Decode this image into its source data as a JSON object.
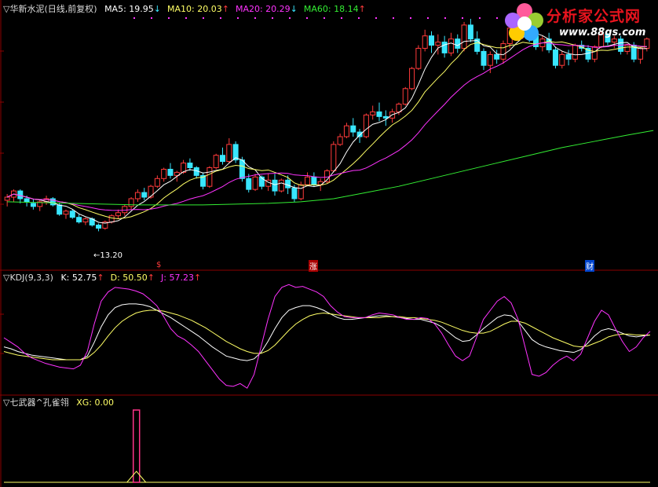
{
  "price_panel": {
    "title": "华新水泥(日线,前复权)",
    "mark": "▽",
    "ma": [
      {
        "label": "MA5:",
        "value": "19.95",
        "arrow": "↓",
        "color": "#ffffff",
        "arrow_color": "#39e6ff"
      },
      {
        "label": "MA10:",
        "value": "20.03",
        "arrow": "↑",
        "color": "#ffff66",
        "arrow_color": "#ff3b3b"
      },
      {
        "label": "MA20:",
        "value": "20.29",
        "arrow": "↓",
        "color": "#ff33ff",
        "arrow_color": "#39e6ff"
      },
      {
        "label": "MA60:",
        "value": "18.14",
        "arrow": "↑",
        "color": "#33ee33",
        "arrow_color": "#ff3b3b"
      }
    ],
    "low_label": "←13.20",
    "markers": [
      "$",
      "涨",
      "财"
    ]
  },
  "kdj_panel": {
    "title": "KDJ(9,3,3)",
    "mark": "▽",
    "items": [
      {
        "label": "K:",
        "value": "52.75",
        "arrow": "↑",
        "color": "#ffffff"
      },
      {
        "label": "D:",
        "value": "50.50",
        "arrow": "↑",
        "color": "#ffff66"
      },
      {
        "label": "J:",
        "value": "57.23",
        "arrow": "↑",
        "color": "#ff33ff"
      }
    ]
  },
  "xg_panel": {
    "title": "七武器^孔雀翎",
    "mark": "▽",
    "label": "XG:",
    "value": "0.00"
  },
  "logo": {
    "text": "分析家公式网",
    "url": "www.88gs.com"
  },
  "colors": {
    "up": "#ff3b3b",
    "down": "#39e6ff",
    "ma5": "#ffffff",
    "ma10": "#ffff66",
    "ma20": "#ff33ff",
    "ma60": "#33ee33",
    "grid": "#8b0000"
  },
  "chart_data": [
    {
      "type": "candlestick",
      "title": "华新水泥(日线,前复权)",
      "ylim": [
        11.5,
        27.0
      ],
      "low_point": 13.2,
      "candles": [
        [
          15.2,
          15.6,
          14.8,
          15.4
        ],
        [
          15.4,
          15.9,
          15.1,
          15.8
        ],
        [
          15.8,
          15.9,
          15.0,
          15.3
        ],
        [
          15.3,
          15.5,
          14.8,
          15.1
        ],
        [
          15.0,
          15.3,
          14.6,
          14.8
        ],
        [
          14.8,
          15.2,
          14.5,
          15.1
        ],
        [
          15.1,
          15.5,
          14.9,
          15.3
        ],
        [
          15.3,
          15.4,
          14.8,
          14.9
        ],
        [
          14.9,
          15.0,
          14.2,
          14.3
        ],
        [
          14.3,
          14.6,
          14.0,
          14.5
        ],
        [
          14.5,
          14.6,
          14.0,
          14.1
        ],
        [
          14.1,
          14.3,
          13.7,
          13.8
        ],
        [
          13.8,
          14.1,
          13.6,
          14.0
        ],
        [
          14.0,
          14.1,
          13.5,
          13.6
        ],
        [
          13.6,
          13.7,
          13.2,
          13.4
        ],
        [
          13.4,
          13.9,
          13.3,
          13.8
        ],
        [
          13.8,
          14.3,
          13.7,
          14.2
        ],
        [
          14.2,
          14.6,
          14.0,
          14.4
        ],
        [
          14.4,
          14.9,
          14.2,
          14.8
        ],
        [
          14.8,
          15.4,
          14.6,
          15.3
        ],
        [
          15.3,
          15.9,
          15.1,
          15.7
        ],
        [
          15.7,
          16.0,
          15.2,
          15.4
        ],
        [
          15.4,
          16.2,
          15.3,
          16.1
        ],
        [
          16.1,
          16.8,
          16.0,
          16.6
        ],
        [
          16.6,
          17.3,
          16.4,
          17.2
        ],
        [
          17.2,
          17.6,
          16.6,
          16.8
        ],
        [
          16.8,
          17.1,
          16.4,
          17.0
        ],
        [
          17.0,
          17.8,
          16.9,
          17.6
        ],
        [
          17.6,
          17.9,
          17.1,
          17.3
        ],
        [
          17.3,
          17.4,
          16.6,
          16.8
        ],
        [
          16.8,
          17.0,
          15.9,
          16.1
        ],
        [
          16.1,
          17.4,
          16.0,
          17.3
        ],
        [
          17.3,
          18.2,
          17.2,
          18.1
        ],
        [
          18.1,
          18.6,
          17.5,
          17.7
        ],
        [
          17.7,
          19.2,
          17.6,
          18.8
        ],
        [
          18.8,
          19.0,
          17.6,
          17.8
        ],
        [
          17.8,
          18.0,
          16.4,
          16.6
        ],
        [
          16.6,
          16.9,
          15.7,
          15.9
        ],
        [
          15.9,
          16.9,
          15.8,
          16.7
        ],
        [
          16.7,
          16.8,
          15.9,
          16.1
        ],
        [
          16.1,
          16.9,
          15.8,
          16.5
        ],
        [
          16.5,
          16.9,
          15.5,
          15.8
        ],
        [
          15.8,
          16.6,
          15.7,
          16.5
        ],
        [
          16.5,
          16.8,
          15.6,
          16.0
        ],
        [
          16.0,
          16.2,
          15.1,
          15.3
        ],
        [
          15.3,
          16.4,
          15.2,
          16.2
        ],
        [
          16.2,
          17.0,
          16.1,
          16.7
        ],
        [
          16.7,
          17.0,
          16.1,
          16.2
        ],
        [
          16.2,
          16.6,
          15.8,
          16.4
        ],
        [
          16.4,
          17.2,
          16.3,
          17.1
        ],
        [
          17.1,
          19.0,
          17.0,
          18.8
        ],
        [
          18.8,
          19.5,
          18.7,
          19.3
        ],
        [
          19.3,
          20.2,
          19.2,
          20.0
        ],
        [
          20.0,
          20.5,
          19.3,
          19.6
        ],
        [
          19.6,
          19.8,
          18.9,
          19.3
        ],
        [
          19.3,
          20.8,
          19.2,
          20.7
        ],
        [
          20.7,
          21.3,
          20.4,
          20.9
        ],
        [
          20.9,
          21.5,
          20.3,
          20.6
        ],
        [
          20.6,
          21.0,
          20.0,
          20.5
        ],
        [
          20.5,
          21.1,
          20.2,
          20.9
        ],
        [
          20.9,
          21.5,
          20.7,
          21.4
        ],
        [
          21.4,
          22.5,
          21.3,
          22.4
        ],
        [
          22.4,
          23.8,
          22.3,
          23.7
        ],
        [
          23.7,
          25.2,
          23.6,
          25.0
        ],
        [
          25.0,
          26.2,
          24.8,
          25.8
        ],
        [
          25.8,
          26.1,
          24.7,
          25.2
        ],
        [
          25.2,
          25.9,
          24.6,
          25.4
        ],
        [
          25.4,
          25.8,
          24.4,
          24.7
        ],
        [
          24.7,
          26.0,
          24.5,
          25.6
        ],
        [
          25.6,
          25.9,
          24.7,
          25.0
        ],
        [
          25.0,
          26.7,
          24.8,
          26.5
        ],
        [
          26.5,
          26.9,
          25.4,
          25.6
        ],
        [
          25.6,
          26.1,
          24.6,
          24.8
        ],
        [
          24.8,
          25.0,
          23.6,
          23.9
        ],
        [
          23.9,
          24.8,
          23.4,
          24.6
        ],
        [
          24.6,
          24.9,
          24.0,
          24.3
        ],
        [
          24.3,
          25.5,
          24.0,
          25.3
        ],
        [
          25.3,
          26.5,
          25.0,
          26.3
        ],
        [
          26.3,
          27.0,
          25.9,
          26.1
        ],
        [
          26.1,
          26.8,
          25.6,
          26.5
        ],
        [
          26.5,
          26.8,
          25.4,
          25.8
        ],
        [
          25.8,
          26.2,
          24.9,
          25.1
        ],
        [
          25.1,
          25.8,
          24.8,
          25.6
        ],
        [
          25.6,
          26.0,
          24.7,
          24.9
        ],
        [
          24.9,
          25.1,
          23.7,
          23.9
        ],
        [
          23.9,
          24.8,
          23.7,
          24.6
        ],
        [
          24.6,
          24.9,
          23.9,
          24.3
        ],
        [
          24.3,
          25.3,
          24.1,
          25.2
        ],
        [
          25.2,
          25.5,
          24.8,
          25.0
        ],
        [
          25.0,
          25.2,
          24.1,
          24.3
        ],
        [
          24.3,
          25.2,
          24.1,
          25.1
        ],
        [
          25.1,
          26.1,
          25.0,
          25.9
        ],
        [
          25.9,
          26.0,
          25.2,
          25.4
        ],
        [
          25.4,
          25.8,
          25.0,
          25.6
        ],
        [
          25.6,
          25.8,
          24.6,
          24.8
        ],
        [
          24.8,
          25.3,
          24.6,
          25.2
        ],
        [
          25.2,
          25.4,
          24.1,
          24.3
        ],
        [
          24.3,
          25.1,
          24.0,
          25.0
        ],
        [
          25.0,
          25.7,
          24.8,
          25.6
        ]
      ],
      "ma60": [
        [
          0,
          15.1
        ],
        [
          10,
          15.0
        ],
        [
          20,
          14.9
        ],
        [
          30,
          14.9
        ],
        [
          40,
          15.0
        ],
        [
          45,
          15.1
        ],
        [
          50,
          15.3
        ],
        [
          55,
          15.7
        ],
        [
          60,
          16.1
        ],
        [
          65,
          16.6
        ],
        [
          70,
          17.1
        ],
        [
          75,
          17.6
        ],
        [
          80,
          18.1
        ],
        [
          85,
          18.6
        ],
        [
          90,
          19.0
        ],
        [
          95,
          19.4
        ],
        [
          99,
          19.7
        ]
      ]
    },
    {
      "type": "line",
      "title": "KDJ(9,3,3)",
      "ylim": [
        -10,
        110
      ],
      "series": [
        {
          "name": "K",
          "values": [
            40,
            38,
            35,
            33,
            31,
            30,
            29,
            28,
            27,
            26,
            26,
            26,
            30,
            45,
            62,
            75,
            83,
            86,
            87,
            87,
            86,
            84,
            80,
            76,
            72,
            67,
            62,
            57,
            52,
            46,
            40,
            35,
            30,
            28,
            26,
            25,
            27,
            34,
            46,
            60,
            72,
            80,
            83,
            85,
            85,
            83,
            80,
            76,
            72,
            70,
            70,
            71,
            72,
            73,
            74,
            74,
            73,
            72,
            71,
            70,
            70,
            68,
            66,
            62,
            56,
            50,
            46,
            47,
            53,
            60,
            66,
            72,
            75,
            74,
            68,
            58,
            48,
            43,
            40,
            38,
            36,
            35,
            34,
            37,
            44,
            52,
            58,
            60,
            58,
            55,
            52,
            51,
            52,
            53
          ]
        },
        {
          "name": "D",
          "values": [
            35,
            33,
            31,
            30,
            29,
            28,
            27,
            26,
            26,
            26,
            26,
            26,
            28,
            34,
            42,
            52,
            61,
            68,
            73,
            77,
            79,
            80,
            80,
            79,
            77,
            75,
            72,
            69,
            65,
            61,
            56,
            51,
            46,
            42,
            38,
            35,
            33,
            33,
            36,
            42,
            50,
            58,
            65,
            70,
            74,
            76,
            77,
            76,
            75,
            74,
            73,
            72,
            72,
            72,
            72,
            73,
            73,
            73,
            72,
            72,
            71,
            70,
            69,
            67,
            64,
            61,
            58,
            56,
            55,
            55,
            57,
            61,
            65,
            68,
            68,
            66,
            62,
            58,
            54,
            50,
            47,
            44,
            41,
            40,
            41,
            44,
            47,
            51,
            53,
            54,
            54,
            53,
            53,
            53
          ]
        },
        {
          "name": "J",
          "values": [
            50,
            45,
            40,
            33,
            28,
            25,
            22,
            20,
            18,
            17,
            16,
            20,
            35,
            65,
            90,
            100,
            105,
            104,
            103,
            101,
            98,
            92,
            85,
            73,
            60,
            52,
            48,
            42,
            35,
            25,
            15,
            5,
            -2,
            -3,
            0,
            -5,
            10,
            40,
            70,
            95,
            105,
            108,
            105,
            106,
            103,
            100,
            95,
            85,
            78,
            73,
            72,
            72,
            72,
            75,
            77,
            76,
            75,
            72,
            70,
            70,
            72,
            71,
            65,
            55,
            42,
            30,
            25,
            30,
            50,
            70,
            80,
            90,
            95,
            88,
            70,
            40,
            10,
            8,
            12,
            20,
            26,
            30,
            25,
            32,
            50,
            68,
            80,
            75,
            60,
            46,
            35,
            40,
            50,
            57
          ]
        }
      ]
    },
    {
      "type": "line",
      "title": "七武器^孔雀翎",
      "ylim": [
        0,
        1
      ],
      "series": [
        {
          "name": "XG",
          "values": [
            0,
            0,
            0,
            0,
            0,
            0,
            0,
            0,
            0,
            0,
            0,
            0,
            0,
            0,
            0,
            0,
            0,
            0,
            0,
            0,
            1,
            0,
            0,
            0,
            0,
            0,
            0,
            0,
            0,
            0,
            0,
            0,
            0,
            0,
            0,
            0,
            0,
            0,
            0,
            0,
            0,
            0,
            0,
            0,
            0,
            0,
            0,
            0,
            0,
            0,
            0,
            0,
            0,
            0,
            0,
            0,
            0,
            0,
            0,
            0,
            0,
            0,
            0,
            0,
            0,
            0,
            0,
            0,
            0,
            0,
            0,
            0,
            0,
            0,
            0,
            0,
            0,
            0,
            0,
            0,
            0,
            0,
            0,
            0,
            0,
            0,
            0,
            0,
            0,
            0,
            0,
            0,
            0,
            0,
            0,
            0,
            0,
            0,
            0,
            0
          ]
        }
      ]
    }
  ]
}
